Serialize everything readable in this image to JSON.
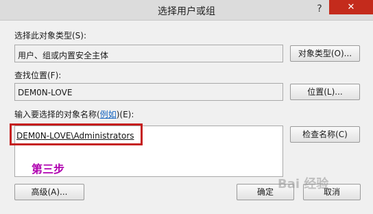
{
  "window": {
    "title": "选择用户或组",
    "help_glyph": "?",
    "close_glyph": "✕"
  },
  "object_type": {
    "label": "选择此对象类型(S):",
    "value": "用户、组或内置安全主体",
    "button": "对象类型(O)..."
  },
  "location": {
    "label": "查找位置(F):",
    "value": "DEM0N-LOVE",
    "button": "位置(L)..."
  },
  "names": {
    "label_prefix": "输入要选择的对象名称(",
    "label_link": "例如",
    "label_suffix": ")(E):",
    "value": "DEM0N-LOVE\\Administrators",
    "check_button": "检查名称(C)"
  },
  "annotation": "第三步",
  "footer": {
    "advanced_button": "高级(A)...",
    "ok_button": "确定",
    "cancel_button": "取消"
  },
  "watermark": "Bai 经验"
}
